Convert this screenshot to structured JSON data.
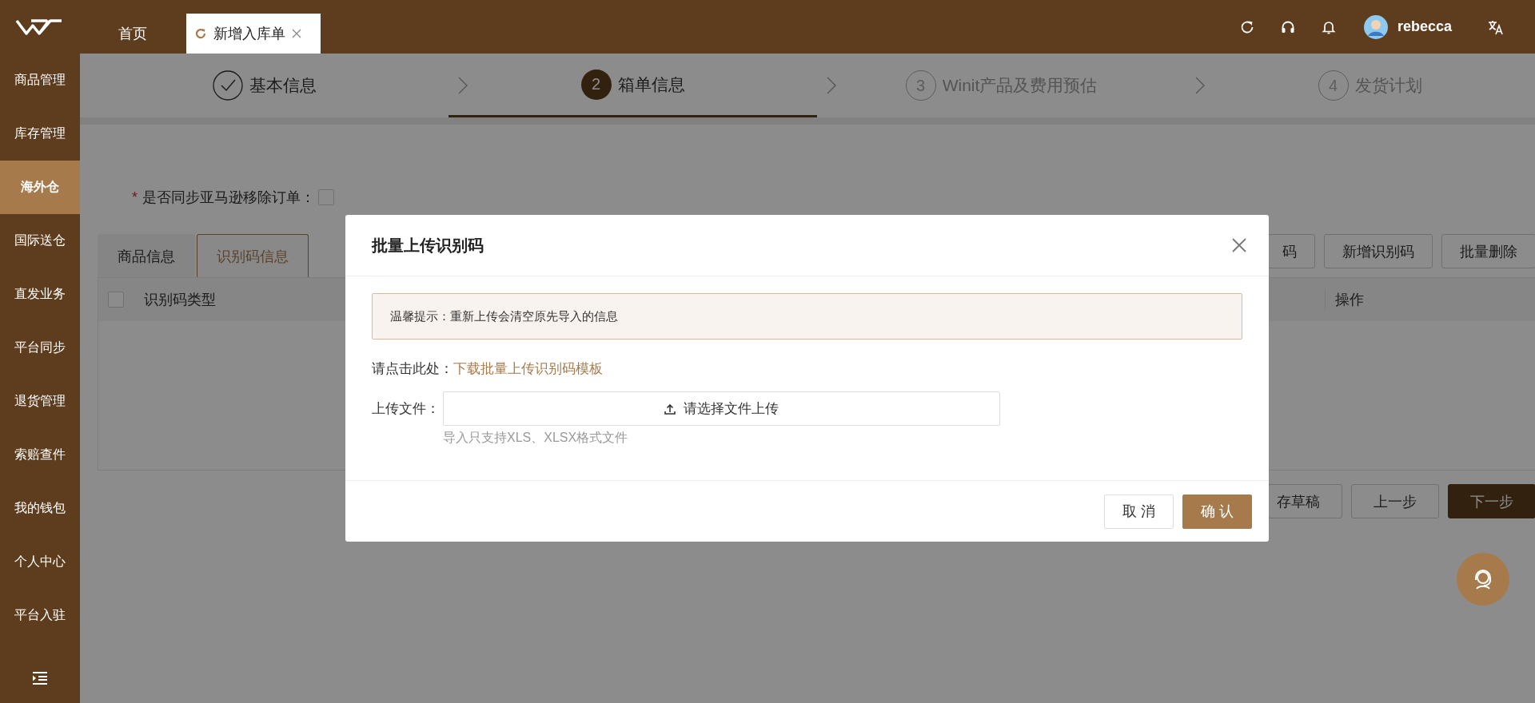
{
  "top_tabs": [
    {
      "label": "首页",
      "selected": false
    },
    {
      "label": "新增入库单",
      "selected": true
    }
  ],
  "user": {
    "name": "rebecca"
  },
  "sidebar": {
    "items": [
      {
        "label": "商品管理",
        "selected": false
      },
      {
        "label": "库存管理",
        "selected": false
      },
      {
        "label": "海外仓",
        "selected": true
      },
      {
        "label": "国际送仓",
        "selected": false
      },
      {
        "label": "直发业务",
        "selected": false
      },
      {
        "label": "平台同步",
        "selected": false
      },
      {
        "label": "退货管理",
        "selected": false
      },
      {
        "label": "索赔查件",
        "selected": false
      },
      {
        "label": "我的钱包",
        "selected": false
      },
      {
        "label": "个人中心",
        "selected": false
      },
      {
        "label": "平台入驻",
        "selected": false
      }
    ]
  },
  "steps": [
    {
      "label": "基本信息",
      "completed": true,
      "selected": false
    },
    {
      "number": "2",
      "label": "箱单信息",
      "completed": false,
      "selected": true
    },
    {
      "number": "3",
      "label": "Winit产品及费用预估",
      "completed": false,
      "selected": false
    },
    {
      "number": "4",
      "label": "发货计划",
      "completed": false,
      "selected": false
    }
  ],
  "sync_field": {
    "required_mark": "*",
    "label": "是否同步亚马逊移除订单：",
    "checked": false
  },
  "sub_tabs": [
    {
      "label": "商品信息",
      "selected": false
    },
    {
      "label": "识别码信息",
      "selected": true
    }
  ],
  "toolbar_buttons": [
    "码",
    "新增识别码",
    "批量删除"
  ],
  "table": {
    "all_checked": false,
    "columns": [
      "识别码类型",
      "操作"
    ]
  },
  "footer_buttons": [
    {
      "label": "存草稿",
      "primary": false
    },
    {
      "label": "上一步",
      "primary": false
    },
    {
      "label": "下一步",
      "primary": true
    }
  ],
  "dialog": {
    "title": "批量上传识别码",
    "notice": "温馨提示：重新上传会清空原先导入的信息",
    "template_label": "请点击此处：",
    "template_link": "下载批量上传识别码模板",
    "upload_label": "上传文件：",
    "upload_button": "请选择文件上传",
    "upload_hint": "导入只支持XLS、XLSX格式文件",
    "buttons": [
      {
        "label": "取 消",
        "primary": false
      },
      {
        "label": "确 认",
        "primary": true
      }
    ]
  }
}
